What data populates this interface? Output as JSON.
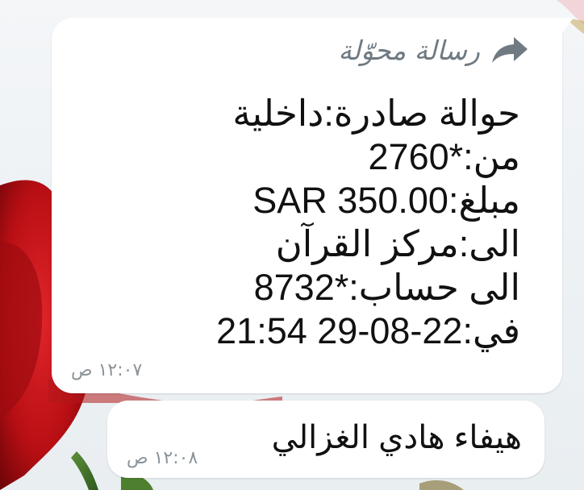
{
  "colors": {
    "bubble": "#ffffff",
    "text": "#111111",
    "meta": "#8a9399",
    "forward_label": "#6f7a82",
    "rose": "#c2161a"
  },
  "forwarded_message": {
    "forward_icon": "forward-arrow-icon",
    "forward_label": "رسالة محوّلة",
    "lines": [
      "حوالة صادرة:داخلية",
      "من:*2760",
      "مبلغ:SAR 350.00",
      "الى:مركز القرآن",
      "الى حساب:*8732",
      "في:22-08-29 21:54"
    ],
    "time": "١٢:٠٧ ص"
  },
  "second_message": {
    "text": "هيفاء هادي الغزالي",
    "time": "١٢:٠٨ ص"
  }
}
